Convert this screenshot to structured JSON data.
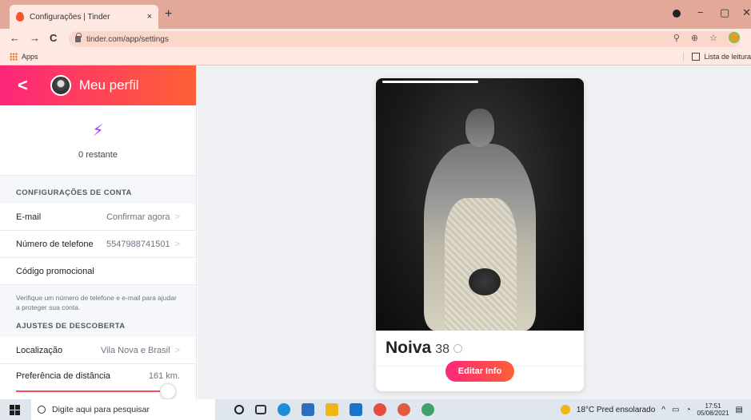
{
  "browser": {
    "tab_title": "Configurações | Tinder",
    "tab_close": "×",
    "new_tab": "+",
    "url": "tinder.com/app/settings",
    "back": "←",
    "forward": "→",
    "reload": "C",
    "minimize": "−",
    "maximize": "▢",
    "close": "✕",
    "bookmark_star": "☆",
    "apps_label": "Apps",
    "reading_list": "Lista de leitura"
  },
  "sidebar": {
    "header_title": "Meu perfil",
    "back_glyph": "<",
    "boost_glyph": "⚡",
    "boost_remaining": "0 restante",
    "account_section": "CONFIGURAÇÕES DE CONTA",
    "rows": {
      "email_label": "E-mail",
      "email_value": "Confirmar agora",
      "phone_label": "Número de telefone",
      "phone_value": "5547988741501",
      "promo_label": "Código promocional"
    },
    "hint": "Verifique um número de telefone e e-mail para ajudar a proteger sua conta.",
    "discovery_section": "AJUSTES DE DESCOBERTA",
    "location_label": "Localização",
    "location_value": "Vila Nova e Brasil",
    "distance_label": "Preferência de distância",
    "distance_value": "161 km.",
    "chevron": ">"
  },
  "card": {
    "name": "Noiva",
    "age": "38",
    "edit_button": "Editar Info"
  },
  "taskbar": {
    "search_placeholder": "Digite aqui para pesquisar",
    "weather": "18°C  Pred ensolarado",
    "time": "17:51",
    "date": "05/08/2021",
    "tray_chevron": "^"
  },
  "colors": {
    "brand_gradient_start": "#fd267a",
    "brand_gradient_end": "#ff6036",
    "boost_purple": "#a53ce7"
  }
}
